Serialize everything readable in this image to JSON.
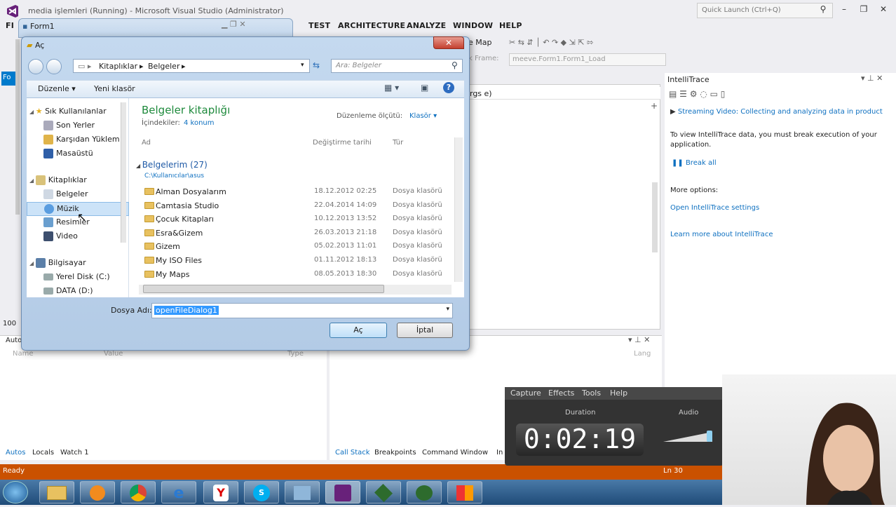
{
  "vs": {
    "title": "media işlemleri (Running) - Microsoft Visual Studio (Administrator)",
    "quick_launch": "Quick Launch (Ctrl+Q)",
    "menu": [
      "TEST",
      "ARCHITECTURE",
      "ANALYZE",
      "WINDOW",
      "HELP"
    ],
    "menu_partial": "FI",
    "toolbar_map": "e Map",
    "frame_label": "k Frame:",
    "frame_value": "meeve.Form1.Form1_Load",
    "editor_text": "rgs e)",
    "left_tab_partial": "Fo",
    "status": "Ready",
    "status_ln": "Ln 30",
    "zoom": "100",
    "autos_partial": "Auto",
    "name_col": "Name",
    "value_col": "Value",
    "type_col": "Type",
    "lang_col": "Lang",
    "bottom_tabs_left": [
      "Autos",
      "Locals",
      "Watch 1"
    ],
    "bottom_tabs_right": [
      "Call Stack",
      "Breakpoints",
      "Command Window",
      "In"
    ]
  },
  "intellitrace": {
    "title": "IntelliTrace",
    "streaming": "Streaming Video: Collecting and analyzing data in product",
    "info": "To view IntelliTrace data, you must break execution of your application.",
    "break_all": "Break all",
    "more_options": "More options:",
    "open_settings": "Open IntelliTrace settings",
    "learn_more": "Learn more about IntelliTrace"
  },
  "form1": {
    "title": "Form1"
  },
  "dialog": {
    "title": "Aç",
    "close": "✕",
    "address": [
      "Kitaplıklar",
      "Belgeler"
    ],
    "search_placeholder": "Ara: Belgeler",
    "organize": "Düzenle ▾",
    "new_folder": "Yeni klasör",
    "library_title": "Belgeler kitaplığı",
    "includes_label": "İçindekiler:",
    "includes_value": "4 konum",
    "arrange_label": "Düzenleme ölçütü:",
    "arrange_value": "Klasör ▾",
    "columns": {
      "name": "Ad",
      "date": "Değiştirme tarihi",
      "type": "Tür"
    },
    "group_title": "Belgelerim (27)",
    "group_path": "C:\\Kullanıcılar\\asus",
    "files": [
      {
        "name": "Alman Dosyalarım",
        "date": "18.12.2012 02:25",
        "type": "Dosya klasörü"
      },
      {
        "name": "Camtasia Studio",
        "date": "22.04.2014 14:09",
        "type": "Dosya klasörü"
      },
      {
        "name": "Çocuk Kitapları",
        "date": "10.12.2013 13:52",
        "type": "Dosya klasörü"
      },
      {
        "name": "Esra&Gizem",
        "date": "26.03.2013 21:18",
        "type": "Dosya klasörü"
      },
      {
        "name": "Gizem",
        "date": "05.02.2013 11:01",
        "type": "Dosya klasörü"
      },
      {
        "name": "My ISO Files",
        "date": "01.11.2012 18:13",
        "type": "Dosya klasörü"
      },
      {
        "name": "My Maps",
        "date": "08.05.2013 18:30",
        "type": "Dosya klasörü"
      }
    ],
    "nav": {
      "favorites": "Sık Kullanılanlar",
      "fav_items": [
        "Son Yerler",
        "Karşıdan Yüklem",
        "Masaüstü"
      ],
      "libraries": "Kitaplıklar",
      "lib_items": [
        "Belgeler",
        "Müzik",
        "Resimler",
        "Video"
      ],
      "computer": "Bilgisayar",
      "comp_items": [
        "Yerel Disk (C:)",
        "DATA (D:)"
      ]
    },
    "filename_label": "Dosya Adı:",
    "filename_value": "openFileDialog1",
    "open_btn": "Aç",
    "cancel_btn": "İptal"
  },
  "recorder": {
    "menu": [
      "Capture",
      "Effects",
      "Tools",
      "Help"
    ],
    "duration_label": "Duration",
    "audio_label": "Audio",
    "timer": "0:02:19"
  },
  "colors": {
    "vs_accent": "#ca5100",
    "link": "#0e70c0",
    "dlg_green": "#1e8a3c"
  }
}
